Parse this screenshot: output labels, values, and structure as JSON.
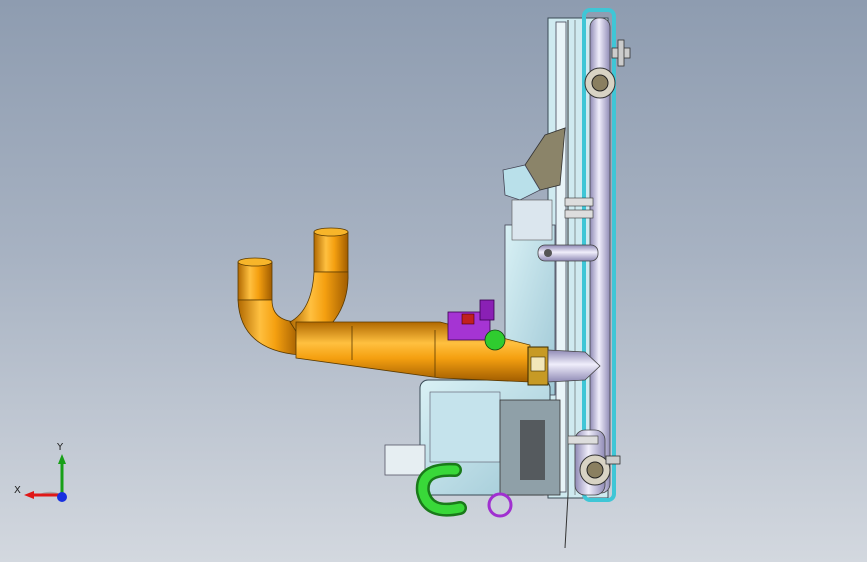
{
  "viewport": {
    "background_top": "#8e9cb0",
    "background_bottom": "#d3d8df"
  },
  "model": {
    "pipe_color": "#f0a010",
    "frame_color": "#6ad3df",
    "pipe_cylinder_color": "#d6d2ee",
    "housing_color": "#bfe6ee",
    "hose_color": "#2fcc2f",
    "valve_color": "#a030d0"
  },
  "triad": {
    "x_label": "X",
    "y_label": "Y",
    "x_color": "#e01818",
    "y_color": "#18a018",
    "z_color": "#1830e0"
  }
}
